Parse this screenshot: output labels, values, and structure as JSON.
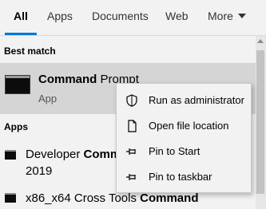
{
  "tabs": [
    {
      "label": "All",
      "active": true
    },
    {
      "label": "Apps"
    },
    {
      "label": "Documents"
    },
    {
      "label": "Web"
    },
    {
      "label": "More"
    }
  ],
  "accent_color": "#0078d7",
  "best_match": {
    "heading": "Best match",
    "title_bold": "Command",
    "title_rest": " Prompt",
    "subtitle": "App",
    "icon": "command-prompt-icon"
  },
  "apps": {
    "heading": "Apps",
    "items": [
      {
        "line1_prefix": "Developer ",
        "line1_bold": "Comm",
        "line2": "2019",
        "icon": "console-app-icon"
      },
      {
        "prefix": "x86_x64 Cross Tools ",
        "bold": "Command",
        "icon": "console-app-icon"
      }
    ]
  },
  "context_menu": {
    "items": [
      {
        "label": "Run as administrator",
        "icon": "shield-icon"
      },
      {
        "label": "Open file location",
        "icon": "file-icon"
      },
      {
        "label": "Pin to Start",
        "icon": "pin-icon"
      },
      {
        "label": "Pin to taskbar",
        "icon": "pin-icon"
      }
    ]
  }
}
